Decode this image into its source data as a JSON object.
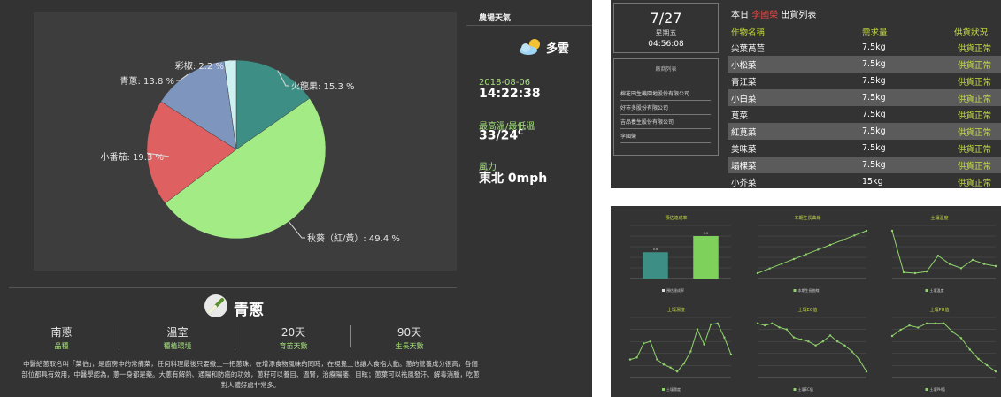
{
  "weather": {
    "header": "農場天氣",
    "condition": "多雲",
    "date": "2018-08-06",
    "time": "14:22:38",
    "temp_label": "最高溫/最低溫",
    "temp_value": "33/24",
    "temp_unit": "C",
    "wind_label": "風力",
    "wind_value": "東北 0mph"
  },
  "pie": {
    "chart_data": {
      "type": "pie",
      "slices": [
        {
          "label": "火龍果: 15.3 %",
          "value": 15.3,
          "color": "#3d8f85"
        },
        {
          "label": "秋葵（紅/黃）: 49.4 %",
          "value": 49.4,
          "color": "#a3ec85"
        },
        {
          "label": "小番茄: 19.3 %",
          "value": 19.3,
          "color": "#df6060"
        },
        {
          "label": "青蔥: 13.8 %",
          "value": 13.8,
          "color": "#7e95bd"
        },
        {
          "label": "彩椒: 2.2 %",
          "value": 2.2,
          "color": "#cdf1f1"
        }
      ]
    }
  },
  "crop": {
    "name": "青蔥",
    "stats": [
      {
        "value": "南蔥",
        "label": "品種"
      },
      {
        "value": "溫室",
        "label": "種植環境"
      },
      {
        "value": "20天",
        "label": "育苗天數"
      },
      {
        "value": "90天",
        "label": "生長天數"
      }
    ],
    "description": "中醫給蔥取名叫「菜伯」，是廚房中的常備菜，任何料理最後只要撒上一把蔥珠，在增添食物風味的同時，在視覺上也讓人食指大動。蔥的營養成分很高，各個部位都具有效用，中醫學認為，蔥一身都是藥。大蔥有解熱、通陽和防癌的功效，蔥籽可以養目、溫腎，治療陽痿、目眩；蔥葉可以祛風發汗、解毒消腫，吃蔥對人體好處非常多。"
  },
  "clock": {
    "date": "7/27",
    "weekday": "星期五",
    "time": "04:56:08"
  },
  "vendors": {
    "title": "廠商列表",
    "items": [
      "棉花田生機園地股份有限公司",
      "好市多股份有限公司",
      "吉品養生股份有限公司",
      "李國榮"
    ]
  },
  "shipping": {
    "title_prefix": "本日",
    "title_person": "李國榮",
    "title_suffix": "出貨列表",
    "headers": [
      "作物名稱",
      "需求量",
      "供貨狀況"
    ],
    "rows": [
      [
        "尖葉萵苣",
        "7.5kg",
        "供貨正常"
      ],
      [
        "小松菜",
        "7.5kg",
        "供貨正常"
      ],
      [
        "青江菜",
        "7.5kg",
        "供貨正常"
      ],
      [
        "小白菜",
        "7.5kg",
        "供貨正常"
      ],
      [
        "莧菜",
        "7.5kg",
        "供貨正常"
      ],
      [
        "紅莧菜",
        "7.5kg",
        "供貨正常"
      ],
      [
        "美味菜",
        "7.5kg",
        "供貨正常"
      ],
      [
        "塌棵菜",
        "7.5kg",
        "供貨正常"
      ],
      [
        "小芥菜",
        "15kg",
        "供貨正常"
      ]
    ]
  },
  "mini_charts": {
    "chart_data": [
      {
        "type": "bar",
        "title": "預估達成率",
        "categories": [
          "",
          ""
        ],
        "values": [
          0.62,
          1.0
        ],
        "value_labels": [
          "0.6",
          "1.0"
        ],
        "colors": [
          "#3d8f85",
          "#7ed15a"
        ],
        "legend": "預估達成率"
      },
      {
        "type": "line",
        "title": "本期生長曲線",
        "values": [
          1,
          2,
          3,
          4,
          5,
          6,
          7,
          8,
          9,
          10
        ],
        "legend": "本期生長曲線"
      },
      {
        "type": "line",
        "title": "土壤溫度",
        "values": [
          30,
          20,
          19.8,
          20.2,
          24,
          22,
          21,
          23,
          22,
          21.5
        ],
        "legend": "土壤溫度"
      },
      {
        "type": "line",
        "title": "土壤濕度",
        "values": [
          3,
          3.2,
          4.6,
          4.8,
          3.0,
          2.5,
          2.2,
          1.8,
          2.6,
          3.8,
          6.0,
          4.5,
          6.5,
          6.6,
          5.2,
          3.5
        ],
        "legend": "土壤濕度"
      },
      {
        "type": "line",
        "title": "土壤EC值",
        "values": [
          6.4,
          6.2,
          6.4,
          6.0,
          5.8,
          5.0,
          4.8,
          4.6,
          4.2,
          4.6,
          5.2,
          4.6,
          4.2,
          3.6,
          2.8,
          1.6
        ],
        "legend": "土壤EC值"
      },
      {
        "type": "line",
        "title": "土壤PH值",
        "values": [
          4.8,
          5.4,
          5.8,
          5.6,
          6.0,
          6.0,
          6.0,
          5.2,
          4.6,
          3.5,
          2.6,
          2.0,
          1.4
        ],
        "legend": "土壤PH值"
      }
    ]
  }
}
